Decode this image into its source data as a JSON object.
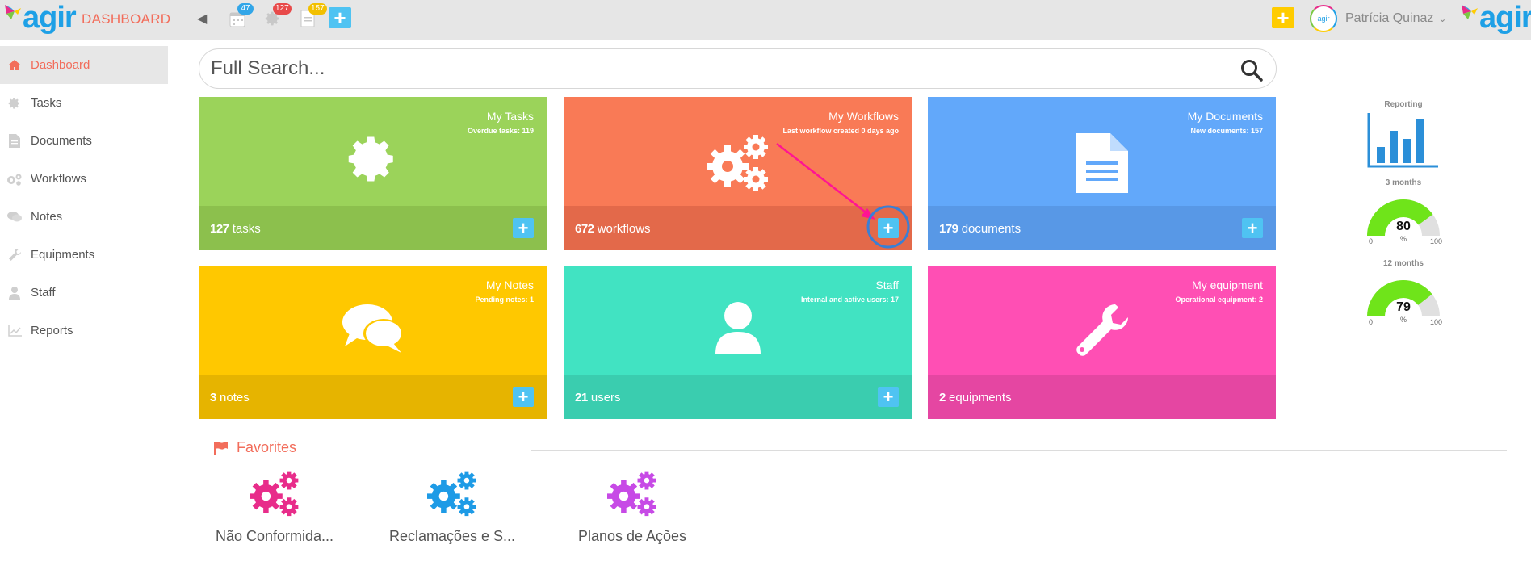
{
  "header": {
    "brand": "agir",
    "section_title": "DASHBOARD",
    "badges": {
      "calendar": "47",
      "settings": "127",
      "documents": "157"
    },
    "user_name": "Patrícia Quinaz",
    "avatar_text": "agir",
    "colors": {
      "accent": "#f26d5b",
      "brand_blue": "#1ea0e6",
      "add_blue": "#4fc3f2",
      "add_yellow": "#ffcc00"
    }
  },
  "sidebar": {
    "items": [
      {
        "label": "Dashboard",
        "icon": "home-icon",
        "active": true
      },
      {
        "label": "Tasks",
        "icon": "gear-icon"
      },
      {
        "label": "Documents",
        "icon": "document-icon"
      },
      {
        "label": "Workflows",
        "icon": "gears-icon"
      },
      {
        "label": "Notes",
        "icon": "chat-icon"
      },
      {
        "label": "Equipments",
        "icon": "wrench-icon"
      },
      {
        "label": "Staff",
        "icon": "user-icon"
      },
      {
        "label": "Reports",
        "icon": "chart-icon"
      }
    ]
  },
  "search": {
    "placeholder": "Full Search..."
  },
  "tiles": [
    {
      "title": "My Tasks",
      "subtitle": "Overdue tasks: 119",
      "count": "127",
      "unit": "tasks",
      "color": "#9bd35a",
      "foot": "#8cc04d",
      "icon": "gear-icon"
    },
    {
      "title": "My Workflows",
      "subtitle": "Last workflow created 0 days ago",
      "count": "672",
      "unit": "workflows",
      "color": "#f97a56",
      "foot": "#e3694a",
      "icon": "gears-icon"
    },
    {
      "title": "My Documents",
      "subtitle": "New documents: 157",
      "count": "179",
      "unit": "documents",
      "color": "#62a8fa",
      "foot": "#5898e6",
      "icon": "document-icon"
    },
    {
      "title": "My Notes",
      "subtitle": "Pending notes: 1",
      "count": "3",
      "unit": "notes",
      "color": "#ffc800",
      "foot": "#e6b400",
      "icon": "chat-icon"
    },
    {
      "title": "Staff",
      "subtitle": "Internal and active users: 17",
      "count": "21",
      "unit": "users",
      "color": "#41e3c2",
      "foot": "#3acdaf",
      "icon": "user-icon"
    },
    {
      "title": "My equipment",
      "subtitle": "Operational equipment: 2",
      "count": "2",
      "unit": "equipments",
      "color": "#ff4fb4",
      "foot": "#e546a2",
      "icon": "wrench-icon"
    }
  ],
  "reporting": {
    "label": "Reporting",
    "gauges": [
      {
        "label": "3 months",
        "value": 80,
        "unit": "%",
        "min": "0",
        "max": "100"
      },
      {
        "label": "12 months",
        "value": 79,
        "unit": "%",
        "min": "0",
        "max": "100"
      }
    ]
  },
  "favorites": {
    "title": "Favorites",
    "items": [
      {
        "label": "Não Conformida...",
        "color": "#e82c8a"
      },
      {
        "label": "Reclamações e S...",
        "color": "#1e9be6"
      },
      {
        "label": "Planos de Ações",
        "color": "#c74ae6"
      }
    ]
  }
}
